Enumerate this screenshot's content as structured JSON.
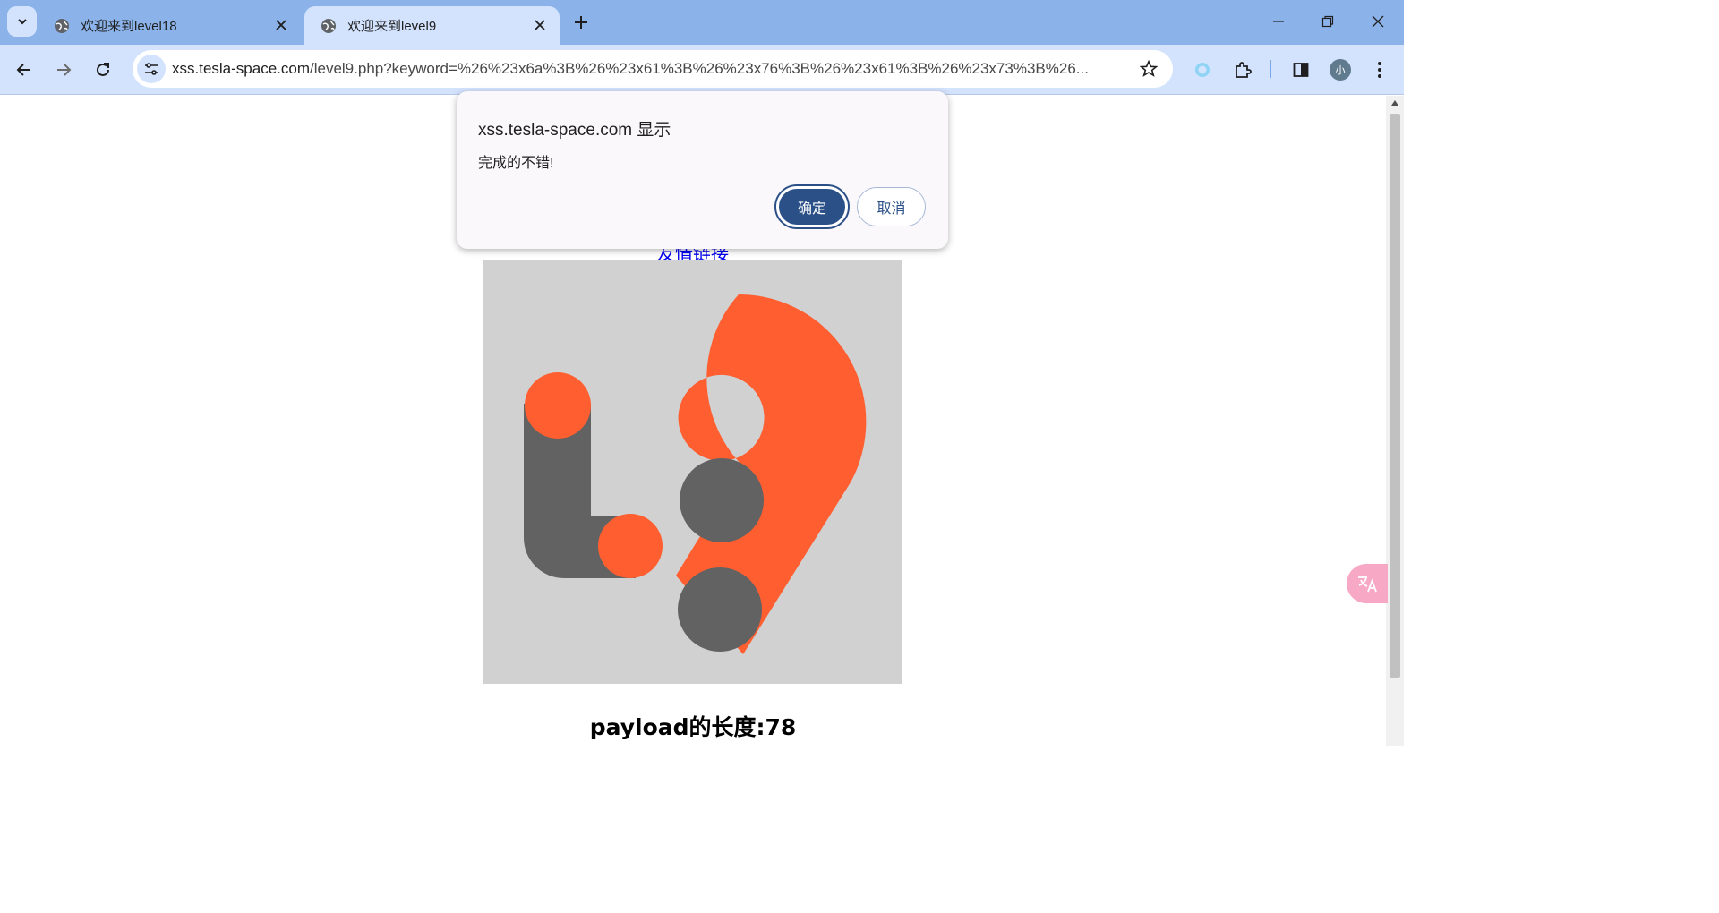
{
  "browser": {
    "tabs": [
      {
        "title": "欢迎来到level18",
        "active": false
      },
      {
        "title": "欢迎来到level9",
        "active": true
      }
    ],
    "address": {
      "host": "xss.tesla-space.com",
      "path": "/level9.php?keyword=%26%23x6a%3B%26%23x61%3B%26%23x76%3B%26%23x61%3B%26%23x73%3B%26..."
    },
    "profile_initial": "小"
  },
  "page": {
    "link_text": "友情链接",
    "payload_length": "payload的长度:78"
  },
  "dialog": {
    "title": "xss.tesla-space.com 显示",
    "message": "完成的不错!",
    "ok_label": "确定",
    "cancel_label": "取消"
  },
  "colors": {
    "tab_strip": "#8bb3ea",
    "toolbar": "#d3e3fd",
    "logo_orange": "#ff5f30",
    "logo_gray": "#626262",
    "dialog_primary": "#2b5088"
  }
}
